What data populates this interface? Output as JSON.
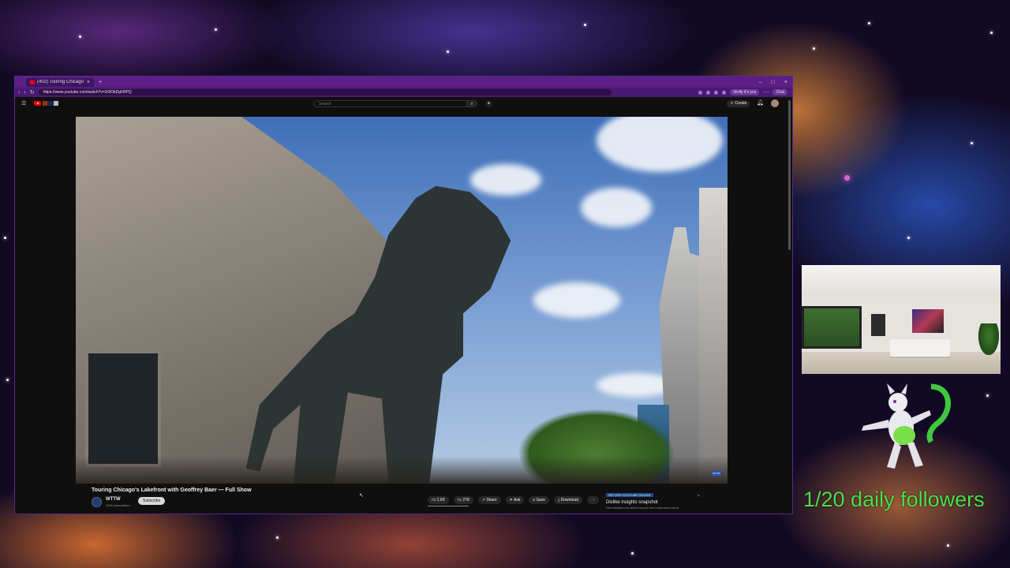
{
  "browser": {
    "tab_title": "(402) Touring Chicago's Lakef",
    "tab_close": "×",
    "new_tab": "+",
    "url": "https://www.youtube.com/watch?v=3r9ObDgN0PQ",
    "window_controls": [
      "–",
      "□",
      "×"
    ],
    "profile_chip": "Verify it's you",
    "chat_chip": "Chat"
  },
  "youtube": {
    "search_placeholder": "Search",
    "create_label": "Create",
    "video_title": "Touring Chicago's Lakefront with Geoffrey Baer — Full Show",
    "channel_name": "WTTW",
    "channel_subs": "114K subscribers",
    "subscribe_label": "Subscribe",
    "actions": {
      "likes": "2.6K",
      "dislikes": "278",
      "share": "Share",
      "ask": "Ask",
      "save": "Save",
      "download": "Download",
      "more": "···"
    },
    "dislike_card": {
      "badge": "RETURN YOUTUBE DISLIKE",
      "title": "Dislike insights snapshot",
      "desc": "New dislikes are direct reports from extension users",
      "close": "×"
    },
    "player_badge": "WTTW"
  },
  "overlay": {
    "followers_text": "1/20 daily followers"
  }
}
